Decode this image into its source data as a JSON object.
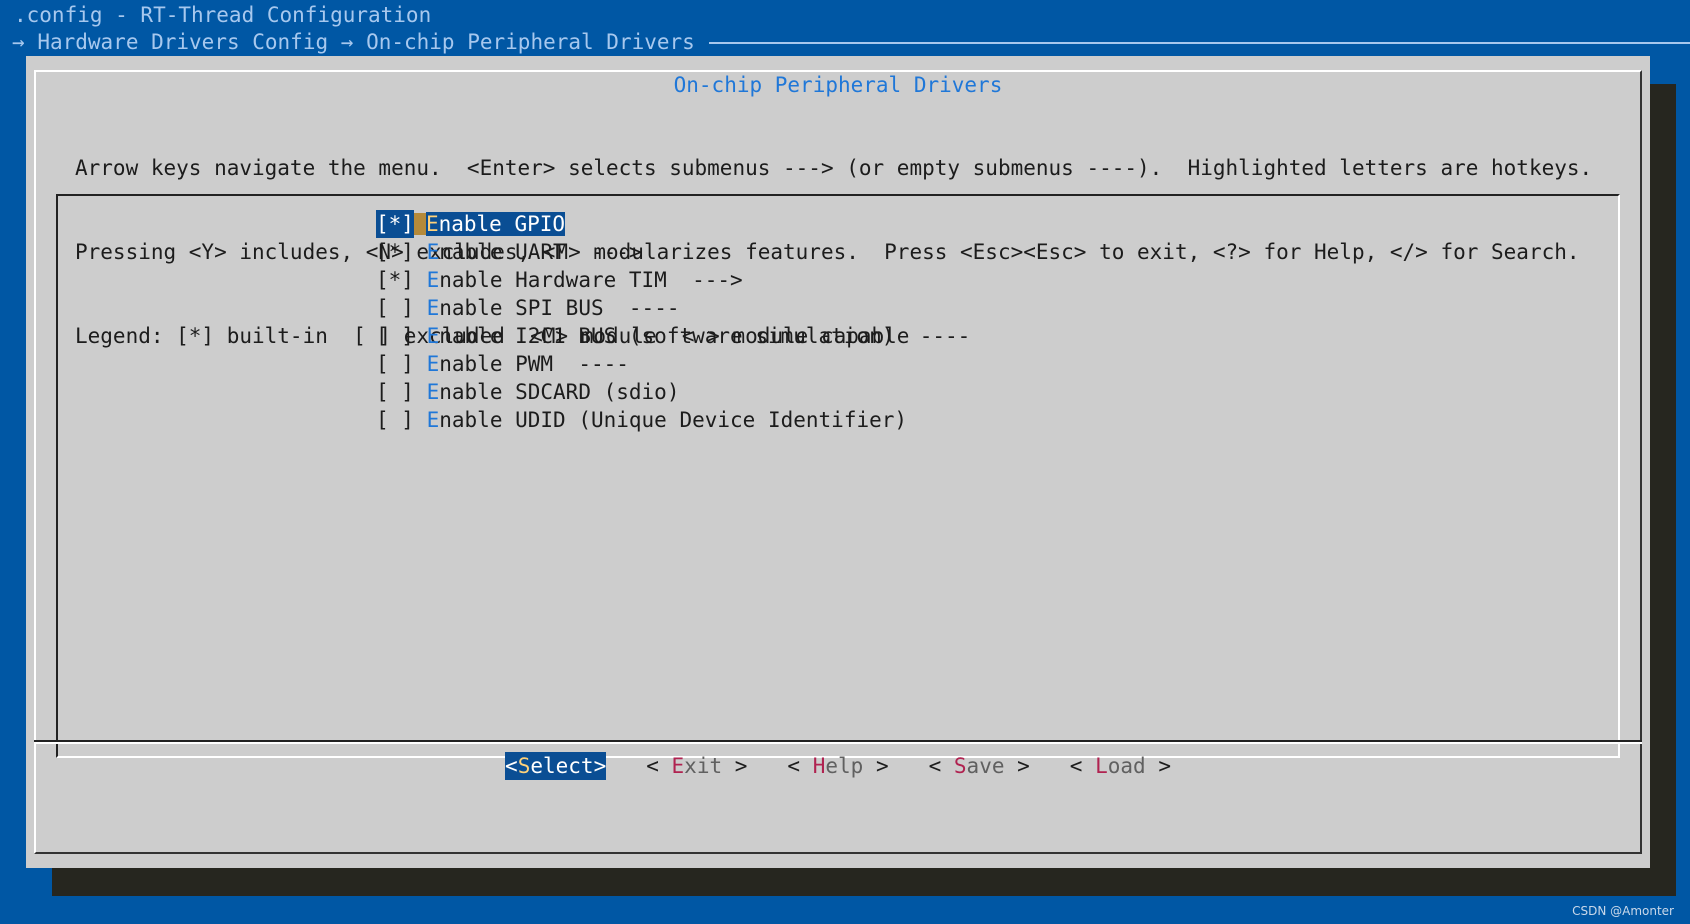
{
  "app_title": ".config - RT-Thread Configuration",
  "breadcrumb": {
    "arrow": "→",
    "parts": [
      "Hardware Drivers Config",
      "On-chip Peripheral Drivers"
    ]
  },
  "dialog": {
    "title": "On-chip Peripheral Drivers",
    "help_lines": [
      "Arrow keys navigate the menu.  <Enter> selects submenus ---> (or empty submenus ----).  Highlighted letters are hotkeys.",
      "Pressing <Y> includes, <N> excludes, <M> modularizes features.  Press <Esc><Esc> to exit, <?> for Help, </> for Search.",
      "Legend: [*] built-in  [ ] excluded  <M> module  < > module capable"
    ]
  },
  "menu": {
    "items": [
      {
        "mark": "[*]",
        "hotkey": "E",
        "rest": "nable GPIO",
        "suffix": "",
        "selected": true
      },
      {
        "mark": "[*]",
        "hotkey": "E",
        "rest": "nable UART",
        "suffix": "  --->",
        "selected": false
      },
      {
        "mark": "[*]",
        "hotkey": "E",
        "rest": "nable Hardware TIM",
        "suffix": "  --->",
        "selected": false
      },
      {
        "mark": "[ ]",
        "hotkey": "E",
        "rest": "nable SPI BUS",
        "suffix": "  ----",
        "selected": false
      },
      {
        "mark": "[ ]",
        "hotkey": "E",
        "rest": "nable I2C1 BUS (software simulation)",
        "suffix": "  ----",
        "selected": false
      },
      {
        "mark": "[ ]",
        "hotkey": "E",
        "rest": "nable PWM",
        "suffix": "  ----",
        "selected": false
      },
      {
        "mark": "[ ]",
        "hotkey": "E",
        "rest": "nable SDCARD (sdio)",
        "suffix": "",
        "selected": false
      },
      {
        "mark": "[ ]",
        "hotkey": "E",
        "rest": "nable UDID (Unique Device Identifier)",
        "suffix": "",
        "selected": false
      }
    ]
  },
  "buttons": {
    "select": {
      "open": "<",
      "hotkey": "S",
      "rest": "elect",
      "close": ">"
    },
    "exit": {
      "open": "< ",
      "hotkey": "E",
      "rest": "xit",
      "close": " >"
    },
    "help": {
      "open": "< ",
      "hotkey": "H",
      "rest": "elp",
      "close": " >"
    },
    "save": {
      "open": "< ",
      "hotkey": "S",
      "rest": "ave",
      "close": " >"
    },
    "load": {
      "open": "< ",
      "hotkey": "L",
      "rest": "oad",
      "close": " >"
    }
  },
  "watermark": "CSDN @Amonter"
}
